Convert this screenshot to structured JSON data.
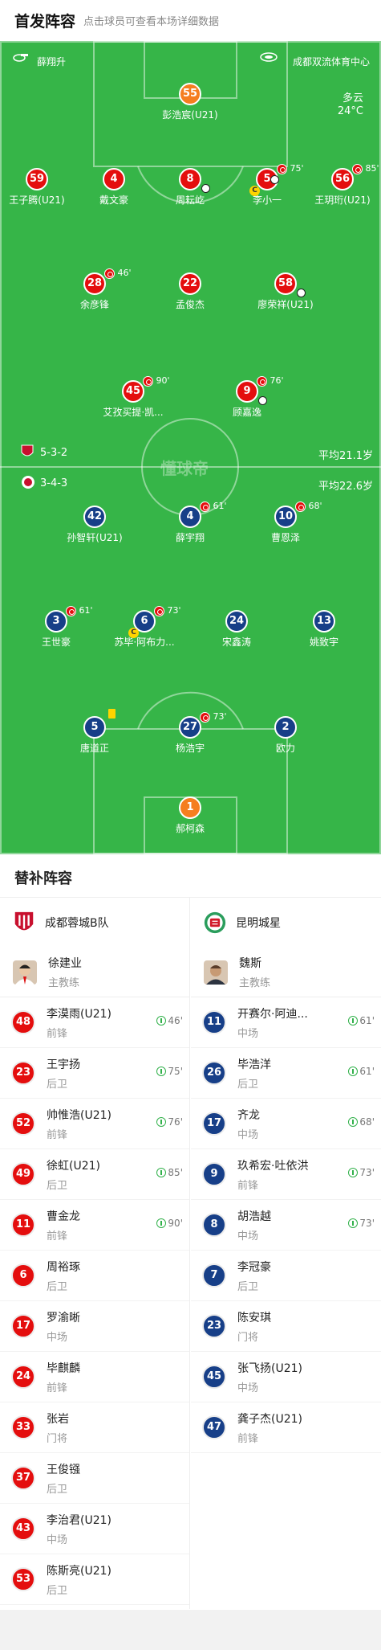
{
  "header": {
    "title": "首发阵容",
    "subtitle": "点击球员可查看本场详细数据"
  },
  "pitch": {
    "referee": "薛翔升",
    "stadium": "成都双流体育中心",
    "weather": "多云",
    "temperature": "24°C",
    "watermark": "懂球帝",
    "home_formation": "5-3-2",
    "home_avg_age": "平均21.1岁",
    "away_formation": "3-4-3",
    "away_avg_age": "平均22.6岁"
  },
  "home_players": [
    {
      "num": "55",
      "name": "彭浩宸(U21)"
    },
    {
      "num": "59",
      "name": "王子腾(U21)"
    },
    {
      "num": "4",
      "name": "戴文豪"
    },
    {
      "num": "8",
      "name": "周耘屹"
    },
    {
      "num": "5",
      "name": "李小一",
      "sub": "75'"
    },
    {
      "num": "56",
      "name": "王玥珩(U21)",
      "sub": "85'"
    },
    {
      "num": "28",
      "name": "余彦锋",
      "sub": "46'"
    },
    {
      "num": "22",
      "name": "孟俊杰"
    },
    {
      "num": "58",
      "name": "廖荣祥(U21)"
    },
    {
      "num": "45",
      "name": "艾孜买提·凯...",
      "sub": "90'"
    },
    {
      "num": "9",
      "name": "顾嘉逸",
      "sub": "76'"
    }
  ],
  "away_players": [
    {
      "num": "42",
      "name": "孙智轩(U21)"
    },
    {
      "num": "4",
      "name": "薛宇翔",
      "sub": "61'"
    },
    {
      "num": "10",
      "name": "曹恩泽",
      "sub": "68'"
    },
    {
      "num": "3",
      "name": "王世豪",
      "sub": "61'"
    },
    {
      "num": "6",
      "name": "苏毕·阿布力...",
      "sub": "73'"
    },
    {
      "num": "24",
      "name": "宋鑫涛"
    },
    {
      "num": "13",
      "name": "姚致宇"
    },
    {
      "num": "5",
      "name": "唐道正"
    },
    {
      "num": "27",
      "name": "杨浩宇",
      "sub": "73'"
    },
    {
      "num": "2",
      "name": "欧力"
    },
    {
      "num": "1",
      "name": "郝柯森"
    }
  ],
  "subs": {
    "title": "替补阵容",
    "home": {
      "team": "成都蓉城B队",
      "coach": {
        "name": "徐建业",
        "role": "主教练"
      },
      "players": [
        {
          "num": "48",
          "name": "李漠雨(U21)",
          "pos": "前锋",
          "in": "46'"
        },
        {
          "num": "23",
          "name": "王宇扬",
          "pos": "后卫",
          "in": "75'"
        },
        {
          "num": "52",
          "name": "帅惟浩(U21)",
          "pos": "前锋",
          "in": "76'"
        },
        {
          "num": "49",
          "name": "徐虹(U21)",
          "pos": "后卫",
          "in": "85'"
        },
        {
          "num": "11",
          "name": "曹金龙",
          "pos": "前锋",
          "in": "90'"
        },
        {
          "num": "6",
          "name": "周裕琢",
          "pos": "后卫"
        },
        {
          "num": "17",
          "name": "罗渝晰",
          "pos": "中场"
        },
        {
          "num": "24",
          "name": "毕麒麟",
          "pos": "前锋"
        },
        {
          "num": "33",
          "name": "张岩",
          "pos": "门将"
        },
        {
          "num": "37",
          "name": "王俊镪",
          "pos": "后卫"
        },
        {
          "num": "43",
          "name": "李治君(U21)",
          "pos": "中场"
        },
        {
          "num": "53",
          "name": "陈斯亮(U21)",
          "pos": "后卫"
        }
      ]
    },
    "away": {
      "team": "昆明城星",
      "coach": {
        "name": "魏斯",
        "role": "主教练"
      },
      "players": [
        {
          "num": "11",
          "name": "开赛尔·阿迪...",
          "pos": "中场",
          "in": "61'"
        },
        {
          "num": "26",
          "name": "毕浩洋",
          "pos": "后卫",
          "in": "61'"
        },
        {
          "num": "17",
          "name": "齐龙",
          "pos": "中场",
          "in": "68'"
        },
        {
          "num": "9",
          "name": "玖希宏·吐依洪",
          "pos": "前锋",
          "in": "73'"
        },
        {
          "num": "8",
          "name": "胡浩越",
          "pos": "中场",
          "in": "73'"
        },
        {
          "num": "7",
          "name": "李冠豪",
          "pos": "后卫"
        },
        {
          "num": "23",
          "name": "陈安琪",
          "pos": "门将"
        },
        {
          "num": "45",
          "name": "张飞扬(U21)",
          "pos": "中场"
        },
        {
          "num": "47",
          "name": "龚子杰(U21)",
          "pos": "前锋"
        }
      ]
    }
  }
}
